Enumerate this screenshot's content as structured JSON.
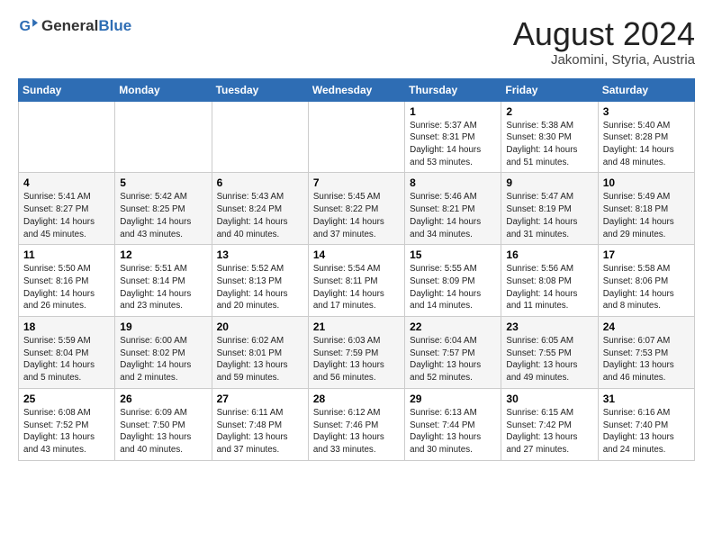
{
  "logo": {
    "text_general": "General",
    "text_blue": "Blue"
  },
  "title": {
    "month_year": "August 2024",
    "location": "Jakomini, Styria, Austria"
  },
  "weekdays": [
    "Sunday",
    "Monday",
    "Tuesday",
    "Wednesday",
    "Thursday",
    "Friday",
    "Saturday"
  ],
  "weeks": [
    [
      {
        "day": "",
        "info": ""
      },
      {
        "day": "",
        "info": ""
      },
      {
        "day": "",
        "info": ""
      },
      {
        "day": "",
        "info": ""
      },
      {
        "day": "1",
        "info": "Sunrise: 5:37 AM\nSunset: 8:31 PM\nDaylight: 14 hours\nand 53 minutes."
      },
      {
        "day": "2",
        "info": "Sunrise: 5:38 AM\nSunset: 8:30 PM\nDaylight: 14 hours\nand 51 minutes."
      },
      {
        "day": "3",
        "info": "Sunrise: 5:40 AM\nSunset: 8:28 PM\nDaylight: 14 hours\nand 48 minutes."
      }
    ],
    [
      {
        "day": "4",
        "info": "Sunrise: 5:41 AM\nSunset: 8:27 PM\nDaylight: 14 hours\nand 45 minutes."
      },
      {
        "day": "5",
        "info": "Sunrise: 5:42 AM\nSunset: 8:25 PM\nDaylight: 14 hours\nand 43 minutes."
      },
      {
        "day": "6",
        "info": "Sunrise: 5:43 AM\nSunset: 8:24 PM\nDaylight: 14 hours\nand 40 minutes."
      },
      {
        "day": "7",
        "info": "Sunrise: 5:45 AM\nSunset: 8:22 PM\nDaylight: 14 hours\nand 37 minutes."
      },
      {
        "day": "8",
        "info": "Sunrise: 5:46 AM\nSunset: 8:21 PM\nDaylight: 14 hours\nand 34 minutes."
      },
      {
        "day": "9",
        "info": "Sunrise: 5:47 AM\nSunset: 8:19 PM\nDaylight: 14 hours\nand 31 minutes."
      },
      {
        "day": "10",
        "info": "Sunrise: 5:49 AM\nSunset: 8:18 PM\nDaylight: 14 hours\nand 29 minutes."
      }
    ],
    [
      {
        "day": "11",
        "info": "Sunrise: 5:50 AM\nSunset: 8:16 PM\nDaylight: 14 hours\nand 26 minutes."
      },
      {
        "day": "12",
        "info": "Sunrise: 5:51 AM\nSunset: 8:14 PM\nDaylight: 14 hours\nand 23 minutes."
      },
      {
        "day": "13",
        "info": "Sunrise: 5:52 AM\nSunset: 8:13 PM\nDaylight: 14 hours\nand 20 minutes."
      },
      {
        "day": "14",
        "info": "Sunrise: 5:54 AM\nSunset: 8:11 PM\nDaylight: 14 hours\nand 17 minutes."
      },
      {
        "day": "15",
        "info": "Sunrise: 5:55 AM\nSunset: 8:09 PM\nDaylight: 14 hours\nand 14 minutes."
      },
      {
        "day": "16",
        "info": "Sunrise: 5:56 AM\nSunset: 8:08 PM\nDaylight: 14 hours\nand 11 minutes."
      },
      {
        "day": "17",
        "info": "Sunrise: 5:58 AM\nSunset: 8:06 PM\nDaylight: 14 hours\nand 8 minutes."
      }
    ],
    [
      {
        "day": "18",
        "info": "Sunrise: 5:59 AM\nSunset: 8:04 PM\nDaylight: 14 hours\nand 5 minutes."
      },
      {
        "day": "19",
        "info": "Sunrise: 6:00 AM\nSunset: 8:02 PM\nDaylight: 14 hours\nand 2 minutes."
      },
      {
        "day": "20",
        "info": "Sunrise: 6:02 AM\nSunset: 8:01 PM\nDaylight: 13 hours\nand 59 minutes."
      },
      {
        "day": "21",
        "info": "Sunrise: 6:03 AM\nSunset: 7:59 PM\nDaylight: 13 hours\nand 56 minutes."
      },
      {
        "day": "22",
        "info": "Sunrise: 6:04 AM\nSunset: 7:57 PM\nDaylight: 13 hours\nand 52 minutes."
      },
      {
        "day": "23",
        "info": "Sunrise: 6:05 AM\nSunset: 7:55 PM\nDaylight: 13 hours\nand 49 minutes."
      },
      {
        "day": "24",
        "info": "Sunrise: 6:07 AM\nSunset: 7:53 PM\nDaylight: 13 hours\nand 46 minutes."
      }
    ],
    [
      {
        "day": "25",
        "info": "Sunrise: 6:08 AM\nSunset: 7:52 PM\nDaylight: 13 hours\nand 43 minutes."
      },
      {
        "day": "26",
        "info": "Sunrise: 6:09 AM\nSunset: 7:50 PM\nDaylight: 13 hours\nand 40 minutes."
      },
      {
        "day": "27",
        "info": "Sunrise: 6:11 AM\nSunset: 7:48 PM\nDaylight: 13 hours\nand 37 minutes."
      },
      {
        "day": "28",
        "info": "Sunrise: 6:12 AM\nSunset: 7:46 PM\nDaylight: 13 hours\nand 33 minutes."
      },
      {
        "day": "29",
        "info": "Sunrise: 6:13 AM\nSunset: 7:44 PM\nDaylight: 13 hours\nand 30 minutes."
      },
      {
        "day": "30",
        "info": "Sunrise: 6:15 AM\nSunset: 7:42 PM\nDaylight: 13 hours\nand 27 minutes."
      },
      {
        "day": "31",
        "info": "Sunrise: 6:16 AM\nSunset: 7:40 PM\nDaylight: 13 hours\nand 24 minutes."
      }
    ]
  ]
}
